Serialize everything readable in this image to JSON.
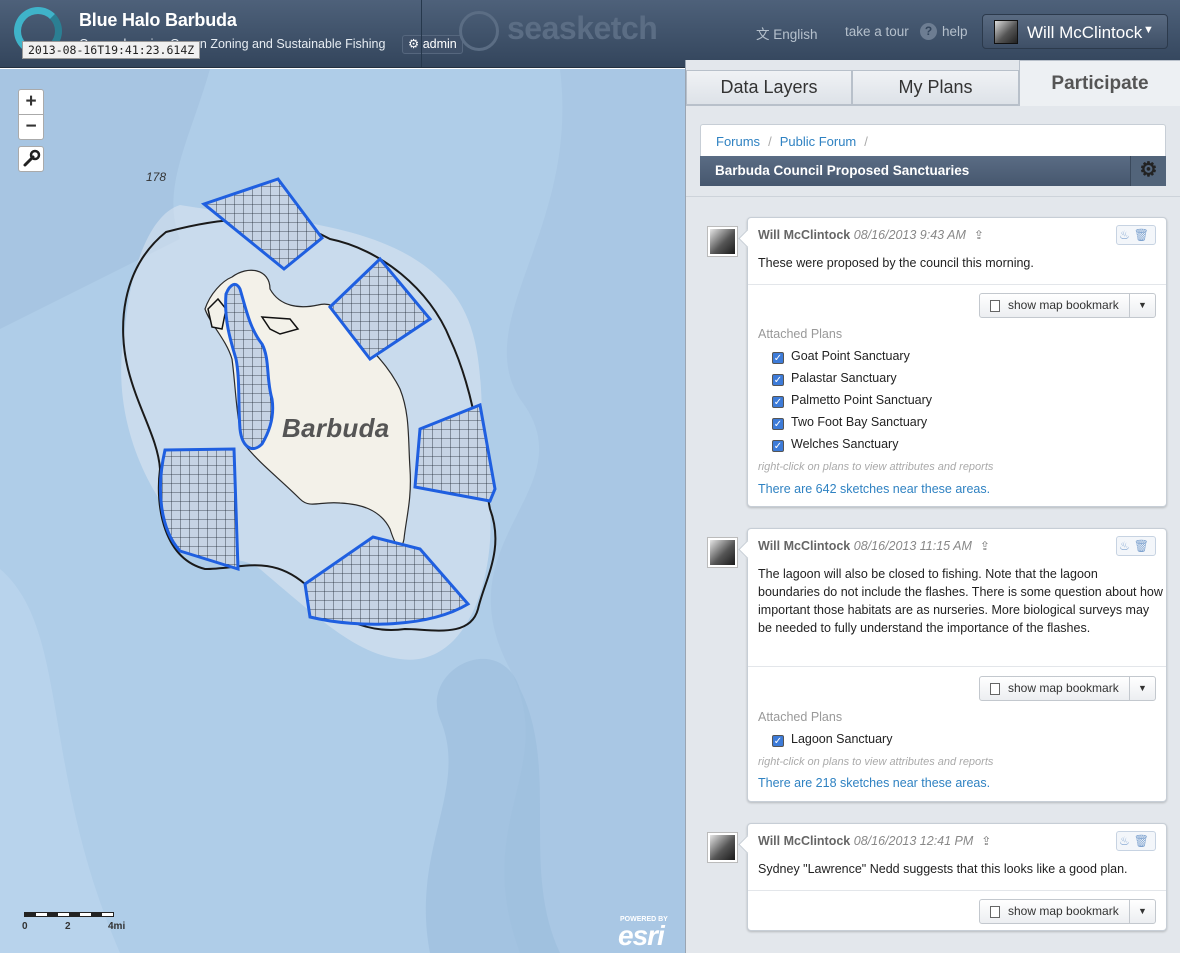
{
  "header": {
    "project_title": "Blue Halo Barbuda",
    "project_subtitle": "Comprehensive Ocean Zoning and Sustainable Fishing",
    "admin_label": "admin",
    "timestamp": "2013-08-16T19:41:23.614Z",
    "brand": "seasketch",
    "language": "English",
    "tour": "take a tour",
    "help_glyph": "?",
    "help": "help",
    "user_name": "Will McClintock"
  },
  "map": {
    "island_label": "Barbuda",
    "depth_label": "178",
    "zoom_in": "+",
    "zoom_out": "−",
    "scale_labels": [
      "0",
      "2",
      "4mi"
    ],
    "attribution_small": "POWERED BY",
    "attribution": "esri",
    "colors": {
      "water": "#afcde8",
      "land": "#f3f1e9",
      "sanctuary": "#1f5fe0"
    }
  },
  "panel": {
    "tabs": [
      "Data Layers",
      "My Plans",
      "Participate"
    ],
    "active_tab": "Participate",
    "breadcrumb": [
      "Forums",
      "Public Forum"
    ],
    "forum_title": "Barbuda Council Proposed Sanctuaries",
    "posts": [
      {
        "author": "Will McClintock",
        "time": "08/16/2013 9:43 AM",
        "body": "These were proposed by the council this morning.",
        "bookmark_label": "show map bookmark",
        "attached_label": "Attached Plans",
        "plans": [
          "Goat Point Sanctuary",
          "Palastar Sanctuary",
          "Palmetto Point Sanctuary",
          "Two Foot Bay Sanctuary",
          "Welches Sanctuary"
        ],
        "hint": "right-click on plans to view attributes and reports",
        "near": "There are 642 sketches near these areas."
      },
      {
        "author": "Will McClintock",
        "time": "08/16/2013 11:15 AM",
        "body": "The lagoon will also be closed to fishing. Note that the lagoon boundaries do not include the flashes. There is some question about how important those habitats are as nurseries. More biological surveys may be needed to fully understand the importance of the flashes.",
        "bookmark_label": "show map bookmark",
        "attached_label": "Attached Plans",
        "plans": [
          "Lagoon Sanctuary"
        ],
        "hint": "right-click on plans to view attributes and reports",
        "near": "There are 218 sketches near these areas."
      },
      {
        "author": "Will McClintock",
        "time": "08/16/2013 12:41 PM",
        "body": "Sydney \"Lawrence\" Nedd suggests that this looks like a good plan.",
        "bookmark_label": "show map bookmark"
      }
    ]
  }
}
